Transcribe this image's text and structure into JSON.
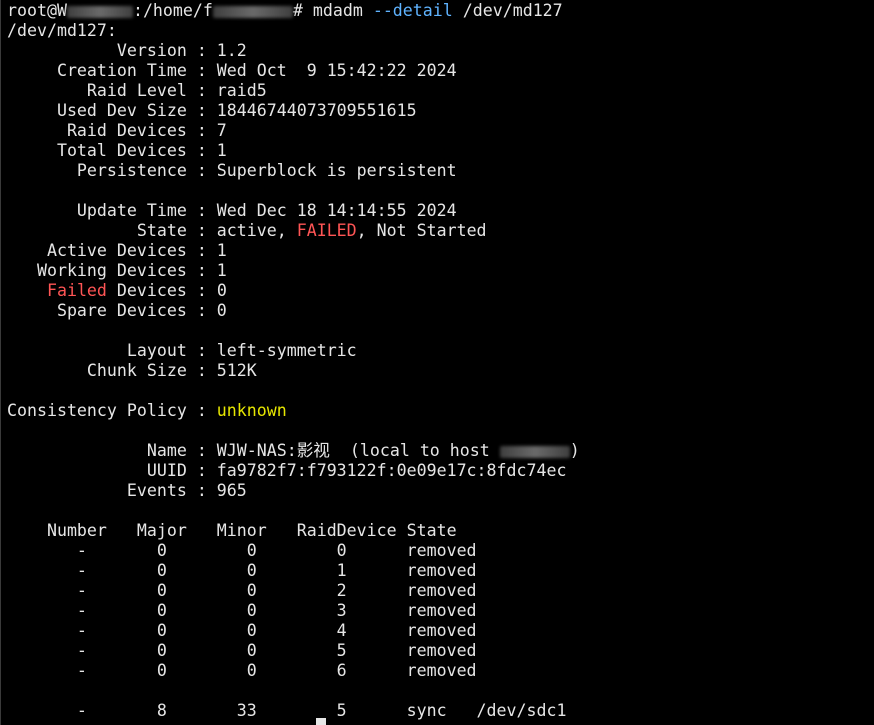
{
  "prompt": {
    "user": "root@W",
    "path_prefix": ":/home/f",
    "path_suffix": "# ",
    "command": "mdadm ",
    "option": "--detail",
    "arg": " /dev/md127"
  },
  "device_header": "/dev/md127:",
  "details": {
    "version": "           Version : 1.2",
    "creation_time": "     Creation Time : Wed Oct  9 15:42:22 2024",
    "raid_level": "        Raid Level : raid5",
    "used_dev_size": "     Used Dev Size : 18446744073709551615",
    "raid_devices": "      Raid Devices : 7",
    "total_devices": "     Total Devices : 1",
    "persistence": "       Persistence : Superblock is persistent",
    "update_time": "       Update Time : Wed Dec 18 14:14:55 2024",
    "state_prefix": "             State : active, ",
    "state_failed": "FAILED",
    "state_suffix": ", Not Started",
    "active_devices": "    Active Devices : 1",
    "working_devices": "   Working Devices : 1",
    "failed_pad": "    ",
    "failed_word": "Failed",
    "failed_rest": " Devices : 0",
    "spare_devices": "     Spare Devices : 0",
    "layout": "            Layout : left-symmetric",
    "chunk_size": "        Chunk Size : 512K",
    "consistency_prefix": "Consistency Policy : ",
    "consistency_value": "unknown",
    "name_prefix": "              Name : WJW-NAS:影视  (local to host ",
    "name_suffix": ")",
    "uuid": "              UUID : fa9782f7:f793122f:0e09e17c:8fdc74ec",
    "events": "            Events : 965"
  },
  "table": {
    "header": "    Number   Major   Minor   RaidDevice State",
    "rows": [
      "       -       0        0        0      removed",
      "       -       0        0        1      removed",
      "       -       0        0        2      removed",
      "       -       0        0        3      removed",
      "       -       0        0        4      removed",
      "       -       0        0        5      removed",
      "       -       0        0        6      removed"
    ],
    "last_row": "       -       8       33        5      sync   /dev/sdc1"
  }
}
